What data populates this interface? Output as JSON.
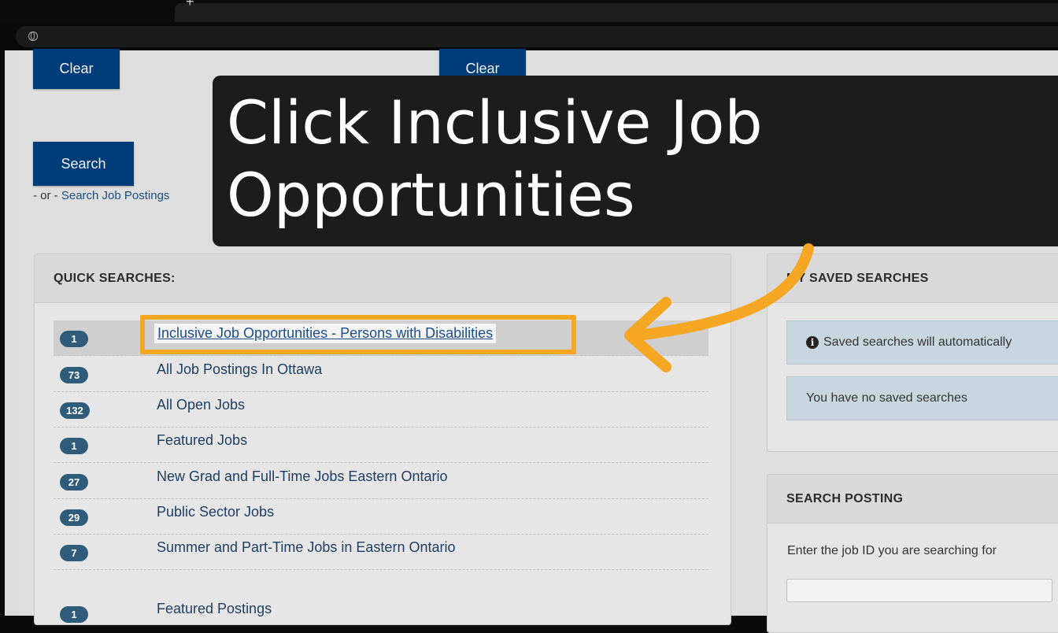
{
  "buttons": {
    "clear_left": "Clear",
    "clear_right": "Clear",
    "search": "Search"
  },
  "search_alt": {
    "prefix": "- or - ",
    "link": "Search Job Postings"
  },
  "quick_searches": {
    "title": "QUICK SEARCHES:",
    "items": [
      {
        "count": "1",
        "label": "Inclusive Job Opportunities - Persons with Disabilities"
      },
      {
        "count": "73",
        "label": "All Job Postings In Ottawa"
      },
      {
        "count": "132",
        "label": "All Open Jobs"
      },
      {
        "count": "1",
        "label": "Featured Jobs"
      },
      {
        "count": "27",
        "label": "New Grad and Full-Time Jobs Eastern Ontario"
      },
      {
        "count": "29",
        "label": "Public Sector Jobs"
      },
      {
        "count": "7",
        "label": "Summer and Part-Time Jobs in Eastern Ontario"
      }
    ],
    "featured": {
      "count": "1",
      "label": "Featured Postings"
    }
  },
  "saved_searches": {
    "title": "MY SAVED SEARCHES",
    "title_visible": "Y SAVED SEARCHES",
    "info_text": "Saved searches will automatically",
    "empty_text": "You have no saved searches"
  },
  "search_posting": {
    "title": "SEARCH POSTING",
    "prompt": "Enter the job ID you are searching for",
    "input_value": ""
  },
  "overlay": {
    "line1": "Click Inclusive Job",
    "line2": "Opportunities"
  },
  "colors": {
    "button_blue": "#003c7a",
    "badge_blue": "#2f5c7a",
    "highlight_orange": "#f5a623",
    "callout_bg": "#1c1c1c"
  }
}
